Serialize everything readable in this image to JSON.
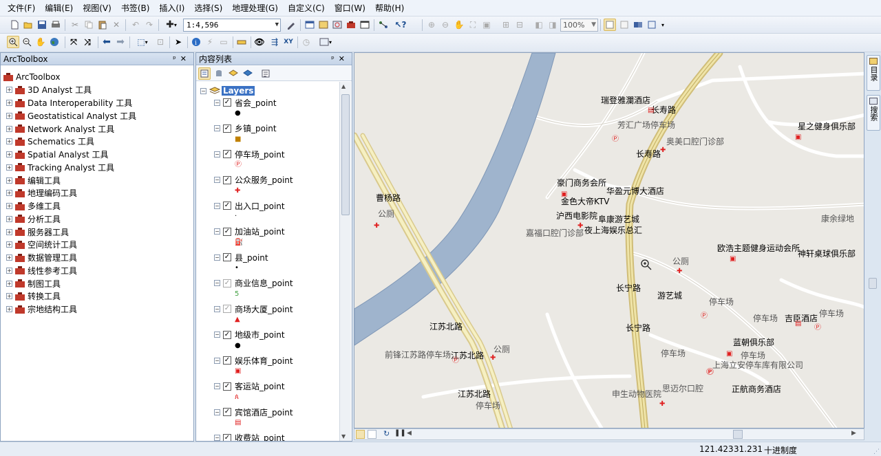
{
  "menu": [
    "文件(F)",
    "编辑(E)",
    "视图(V)",
    "书签(B)",
    "插入(I)",
    "选择(S)",
    "地理处理(G)",
    "自定义(C)",
    "窗口(W)",
    "帮助(H)"
  ],
  "toolbar": {
    "scale_value": "1:4,596",
    "zoom_percent": "100%"
  },
  "toolbox": {
    "title": "ArcToolbox",
    "root": "ArcToolbox",
    "items": [
      "3D Analyst 工具",
      "Data Interoperability 工具",
      "Geostatistical Analyst 工具",
      "Network Analyst 工具",
      "Schematics 工具",
      "Spatial Analyst 工具",
      "Tracking Analyst 工具",
      "编辑工具",
      "地理编码工具",
      "多维工具",
      "分析工具",
      "服务器工具",
      "空间统计工具",
      "数据管理工具",
      "线性参考工具",
      "制图工具",
      "转换工具",
      "宗地结构工具"
    ]
  },
  "toc": {
    "title": "内容列表",
    "root": "Layers",
    "layers": [
      {
        "name": "省会_point",
        "checked": true,
        "symbol": "●",
        "color": "#000000"
      },
      {
        "name": "乡镇_point",
        "checked": true,
        "symbol": "■",
        "color": "#c08000"
      },
      {
        "name": "停车场_point",
        "checked": true,
        "symbol": "Ⓟ",
        "color": "#e02020"
      },
      {
        "name": "公众服务_point",
        "checked": true,
        "symbol": "✚",
        "color": "#e02020"
      },
      {
        "name": "出入口_point",
        "checked": true,
        "symbol": "·",
        "color": "#000000"
      },
      {
        "name": "加油站_point",
        "checked": true,
        "symbol": "⛽",
        "color": "#e02020"
      },
      {
        "name": "县_point",
        "checked": true,
        "symbol": "•",
        "color": "#000000"
      },
      {
        "name": "商业信息_point",
        "checked": false,
        "symbol": "5",
        "color": "#40a040"
      },
      {
        "name": "商场大厦_point",
        "checked": false,
        "symbol": "▲",
        "color": "#e02020"
      },
      {
        "name": "地级市_point",
        "checked": true,
        "symbol": "●",
        "color": "#000000"
      },
      {
        "name": "娱乐体育_point",
        "checked": true,
        "symbol": "▣",
        "color": "#e02020"
      },
      {
        "name": "客运站_point",
        "checked": true,
        "symbol": "ጰ",
        "color": "#e02020"
      },
      {
        "name": "宾馆酒店_point",
        "checked": true,
        "symbol": "▤",
        "color": "#e02020"
      },
      {
        "name": "收费站_point",
        "checked": true,
        "symbol": "",
        "color": "#e02020"
      }
    ]
  },
  "map": {
    "labels": [
      {
        "text": "瑞登雅瀾酒店",
        "kind": "hotel"
      },
      {
        "text": "长寿路",
        "kind": "road"
      },
      {
        "text": "芳汇广场停车场",
        "kind": "parking"
      },
      {
        "text": "奥美口腔门诊部",
        "kind": "public"
      },
      {
        "text": "长寿路",
        "kind": "road"
      },
      {
        "text": "星之健身俱乐部",
        "kind": "ent"
      },
      {
        "text": "豪门商务会所",
        "kind": "ent"
      },
      {
        "text": "华盈元博大酒店",
        "kind": "hotel"
      },
      {
        "text": "金色大帝KTV",
        "kind": "ent"
      },
      {
        "text": "曹杨路",
        "kind": "road"
      },
      {
        "text": "沪西电影院",
        "kind": "ent"
      },
      {
        "text": "阜康游艺城",
        "kind": "ent"
      },
      {
        "text": "公厕",
        "kind": "public"
      },
      {
        "text": "嘉福口腔门诊部",
        "kind": "public"
      },
      {
        "text": "夜上海娱乐总汇",
        "kind": "ent"
      },
      {
        "text": "康余绿地",
        "kind": "public"
      },
      {
        "text": "公厕",
        "kind": "public"
      },
      {
        "text": "欧浩主题健身运动会所",
        "kind": "ent"
      },
      {
        "text": "神轩桌球俱乐部",
        "kind": "ent"
      },
      {
        "text": "长宁路",
        "kind": "road"
      },
      {
        "text": "游艺城",
        "kind": "ent"
      },
      {
        "text": "停车场",
        "kind": "parking"
      },
      {
        "text": "停车场",
        "kind": "parking"
      },
      {
        "text": "吉臣酒店",
        "kind": "hotel"
      },
      {
        "text": "停车场",
        "kind": "parking"
      },
      {
        "text": "江苏北路",
        "kind": "road"
      },
      {
        "text": "长宁路",
        "kind": "road"
      },
      {
        "text": "蓝朝俱乐部",
        "kind": "ent"
      },
      {
        "text": "公厕",
        "kind": "public"
      },
      {
        "text": "前锋江苏路停车场",
        "kind": "parking"
      },
      {
        "text": "江苏北路",
        "kind": "road"
      },
      {
        "text": "停车场",
        "kind": "parking"
      },
      {
        "text": "停车场",
        "kind": "parking"
      },
      {
        "text": "上海立安停车库有限公司",
        "kind": "parking"
      },
      {
        "text": "思迈尔口腔",
        "kind": "public"
      },
      {
        "text": "申生动物医院",
        "kind": "public"
      },
      {
        "text": "正航商务酒店",
        "kind": "hotel"
      },
      {
        "text": "江苏北路",
        "kind": "road"
      },
      {
        "text": "停车场",
        "kind": "parking"
      }
    ]
  },
  "dock": {
    "tabs": [
      "目录",
      "搜索"
    ]
  },
  "status": {
    "x": "121.423",
    "y": "31.231",
    "units": "十进制度"
  }
}
